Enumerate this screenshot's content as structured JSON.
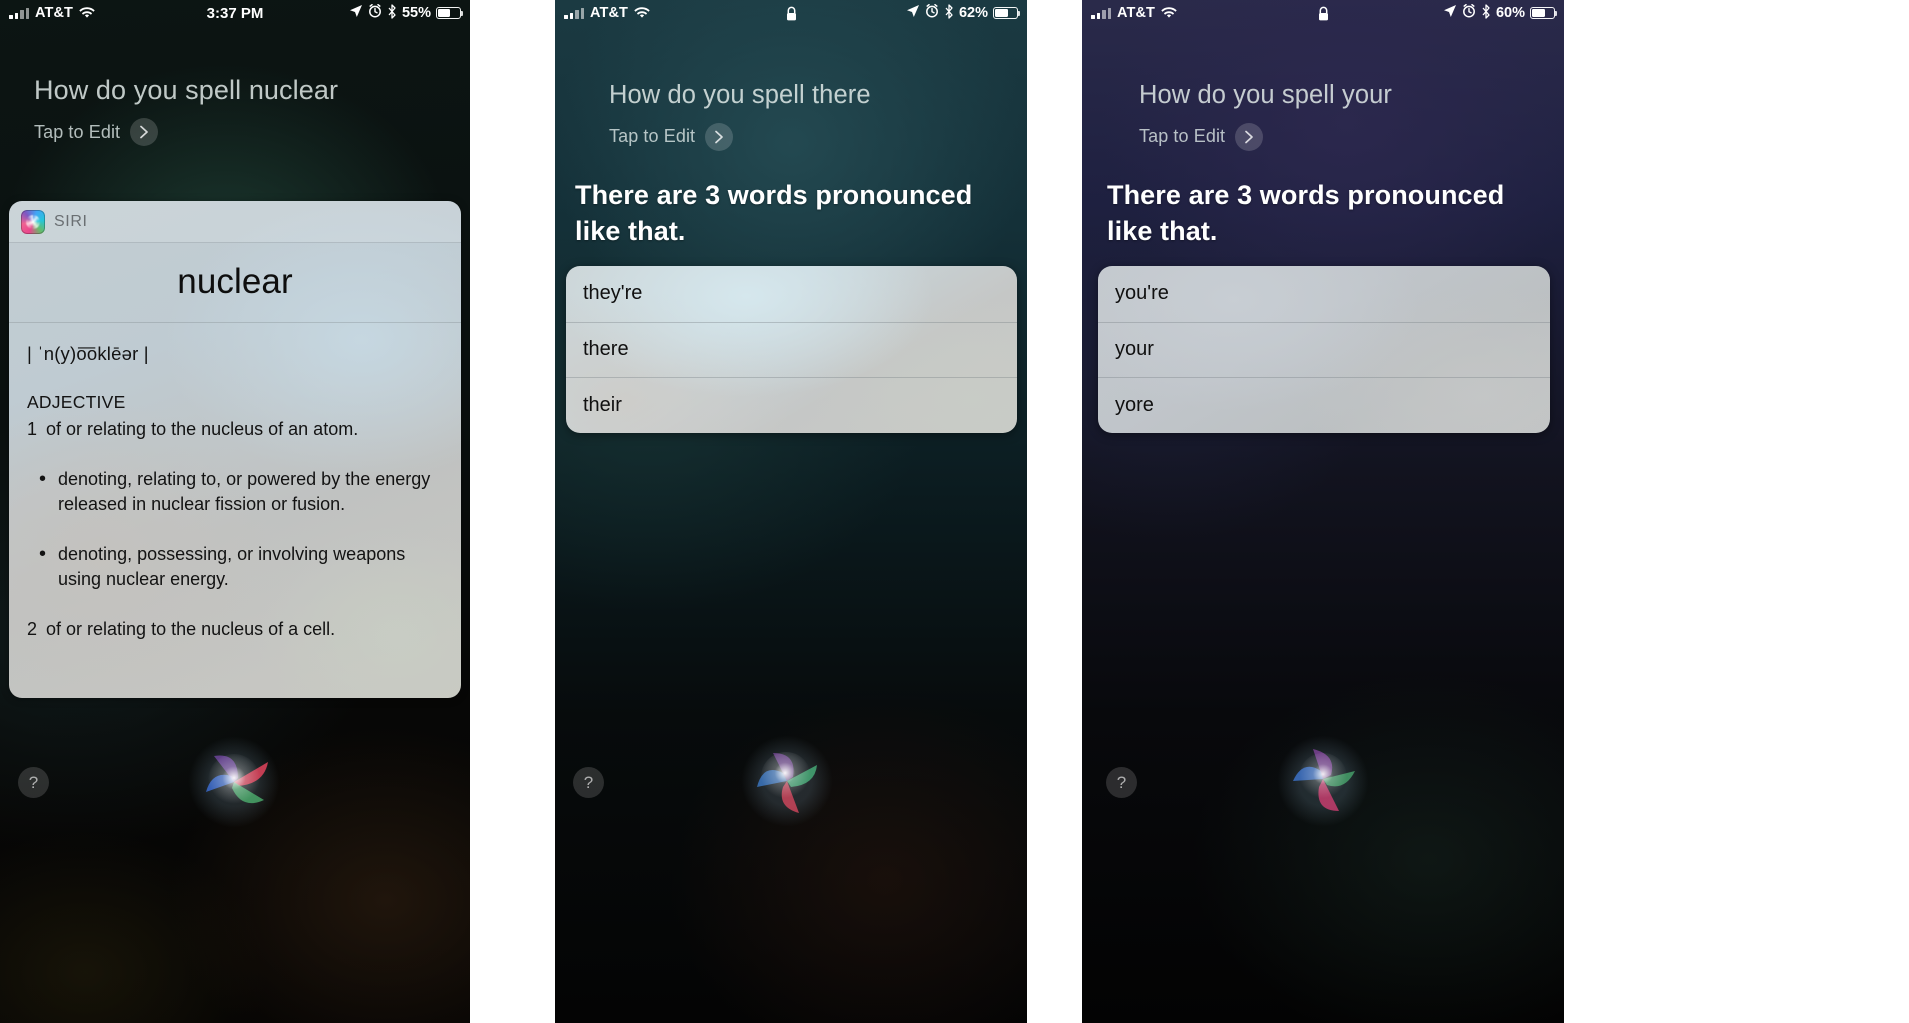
{
  "panels": [
    {
      "status": {
        "carrier": "AT&T",
        "signal_icon": "signal-bars-icon",
        "wifi_icon": "wifi-icon",
        "time": "3:37 PM",
        "location_icon": "location-arrow-icon",
        "alarm_icon": "alarm-clock-icon",
        "bluetooth_icon": "bluetooth-icon",
        "battery_percent": "55%",
        "battery_fill": 55,
        "lock_icon": null
      },
      "query": "How do you spell nuclear",
      "tap_to_edit": "Tap to Edit",
      "chevron_icon": "chevron-right-icon",
      "card": {
        "source_icon": "siri-app-icon",
        "source_label": "SIRI",
        "headword": "nuclear",
        "pronunciation": "| ˈn(y)o͞oklēər |",
        "part_of_speech": "ADJECTIVE",
        "senses": [
          {
            "num": "1",
            "text": "of or relating to the nucleus of an atom."
          },
          {
            "num": "2",
            "text": "of or relating to the nucleus of a cell."
          }
        ],
        "sub_senses": [
          "denoting, relating to, or powered by the energy released in nuclear fission or fusion.",
          "denoting, possessing, or involving weapons using nuclear energy."
        ],
        "bullet_glyph": "•"
      },
      "help_label": "?",
      "siri_orb_icon": "siri-orb-icon"
    },
    {
      "status": {
        "carrier": "AT&T",
        "signal_icon": "signal-bars-icon",
        "wifi_icon": "wifi-icon",
        "time": null,
        "location_icon": "location-arrow-icon",
        "alarm_icon": "alarm-clock-icon",
        "bluetooth_icon": "bluetooth-icon",
        "battery_percent": "62%",
        "battery_fill": 62,
        "lock_icon": "lock-icon"
      },
      "query": "How do you spell there",
      "tap_to_edit": "Tap to Edit",
      "chevron_icon": "chevron-right-icon",
      "answer": "There are 3 words pronounced like that.",
      "words": [
        "they're",
        "there",
        "their"
      ],
      "help_label": "?",
      "siri_orb_icon": "siri-orb-icon"
    },
    {
      "status": {
        "carrier": "AT&T",
        "signal_icon": "signal-bars-icon",
        "wifi_icon": "wifi-icon",
        "time": null,
        "location_icon": "location-arrow-icon",
        "alarm_icon": "alarm-clock-icon",
        "bluetooth_icon": "bluetooth-icon",
        "battery_percent": "60%",
        "battery_fill": 60,
        "lock_icon": "lock-icon"
      },
      "query": "How do you spell your",
      "tap_to_edit": "Tap to Edit",
      "chevron_icon": "chevron-right-icon",
      "answer": "There are 3 words pronounced like that.",
      "words": [
        "you're",
        "your",
        "yore"
      ],
      "help_label": "?",
      "siri_orb_icon": "siri-orb-icon"
    }
  ],
  "colors": {
    "status_text": "#ffffff",
    "query_text": "#e8f0ee",
    "card_text": "#131313",
    "answer_text": "#ffffff"
  }
}
